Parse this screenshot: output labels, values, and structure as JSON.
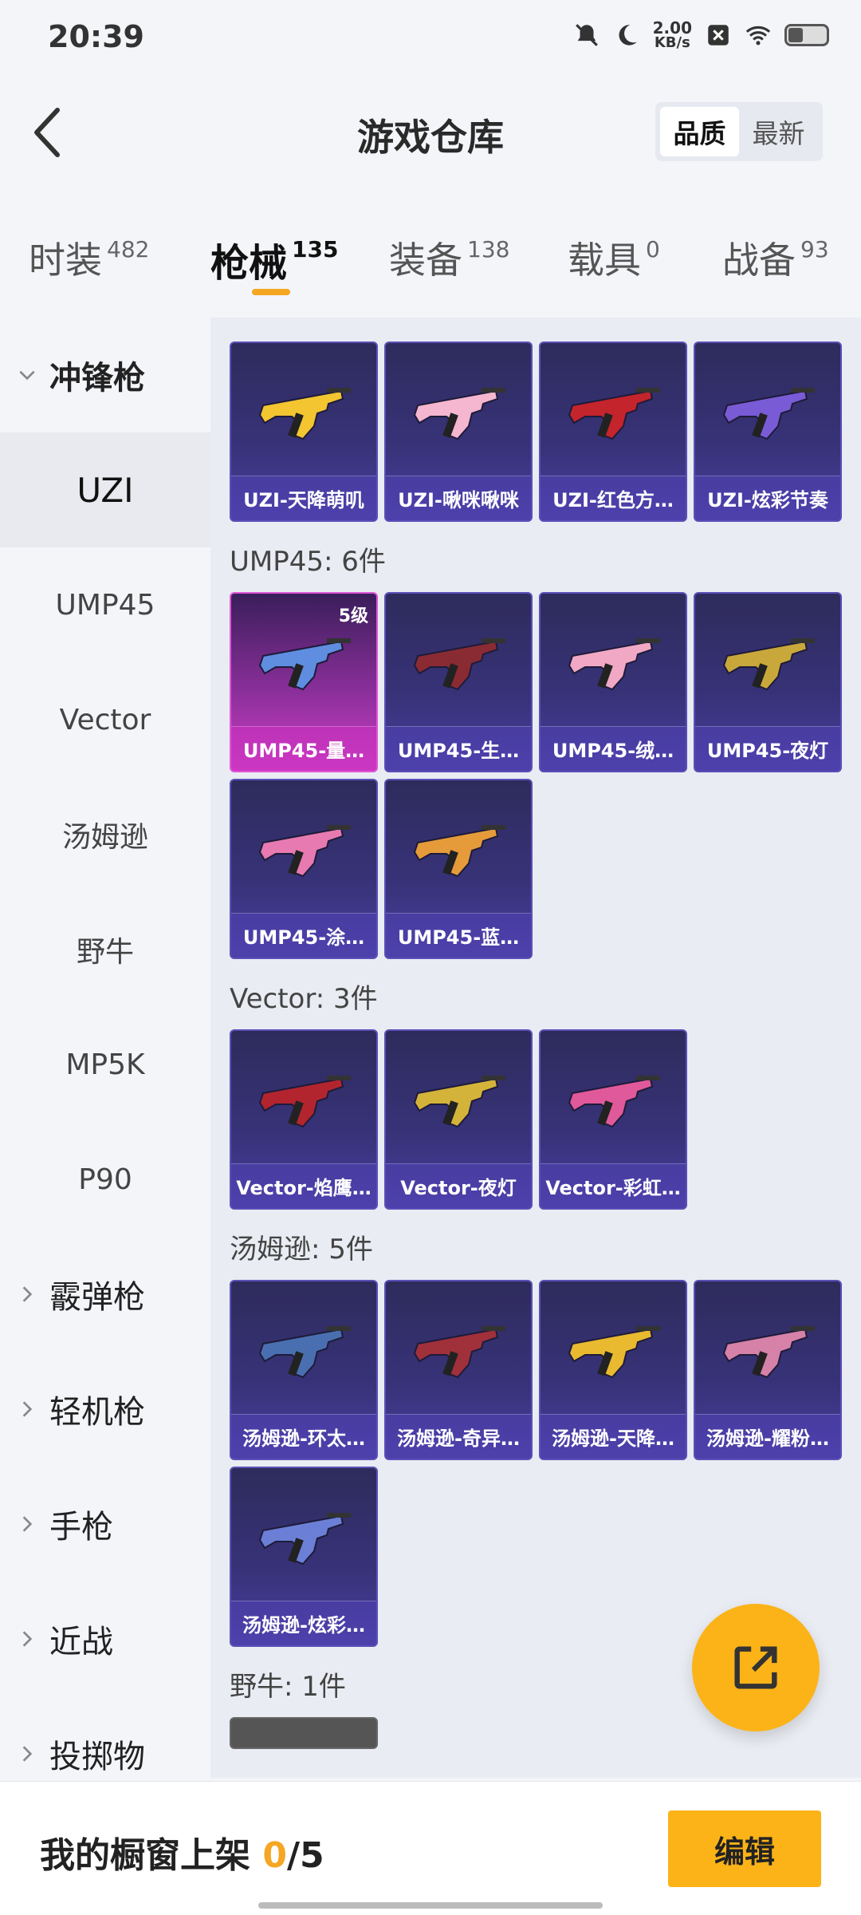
{
  "status": {
    "time": "20:39",
    "net_speed": "2.00",
    "net_unit": "KB/s",
    "icons": [
      "mute-icon",
      "moon-icon",
      "close-box-icon",
      "wifi-icon",
      "battery-icon"
    ]
  },
  "header": {
    "title": "游戏仓库",
    "sort_options": [
      {
        "label": "品质",
        "active": true
      },
      {
        "label": "最新",
        "active": false
      }
    ]
  },
  "categories": [
    {
      "label": "时装",
      "count": "482",
      "active": false
    },
    {
      "label": "枪械",
      "count": "135",
      "active": true
    },
    {
      "label": "装备",
      "count": "138",
      "active": false
    },
    {
      "label": "载具",
      "count": "0",
      "active": false
    },
    {
      "label": "战备",
      "count": "93",
      "active": false
    }
  ],
  "sidebar": {
    "groups": [
      {
        "label": "冲锋枪",
        "open": true
      },
      {
        "label": "霰弹枪"
      },
      {
        "label": "轻机枪"
      },
      {
        "label": "手枪"
      },
      {
        "label": "近战"
      },
      {
        "label": "投掷物"
      }
    ],
    "subitems": [
      {
        "label": "UZI",
        "active": true
      },
      {
        "label": "UMP45"
      },
      {
        "label": "Vector"
      },
      {
        "label": "汤姆逊"
      },
      {
        "label": "野牛"
      },
      {
        "label": "MP5K"
      },
      {
        "label": "P90"
      }
    ]
  },
  "sections": [
    {
      "title": "",
      "items": [
        {
          "name": "UZI-天降萌叽",
          "color": "#f2c531"
        },
        {
          "name": "UZI-啾咪啾咪",
          "color": "#f4b7cf"
        },
        {
          "name": "UZI-红色方…",
          "color": "#c4242b"
        },
        {
          "name": "UZI-炫彩节奏",
          "color": "#7a5bd6"
        }
      ]
    },
    {
      "title": "UMP45: 6件",
      "items": [
        {
          "name": "UMP45-量…",
          "level": "5级",
          "highlight": true,
          "color": "#5f8de0"
        },
        {
          "name": "UMP45-生…",
          "color": "#8a2b33"
        },
        {
          "name": "UMP45-绒…",
          "color": "#f0a8c4"
        },
        {
          "name": "UMP45-夜灯",
          "color": "#c8a83a"
        },
        {
          "name": "UMP45-涂…",
          "color": "#e77ab0"
        },
        {
          "name": "UMP45-蓝…",
          "color": "#e69b3a"
        }
      ]
    },
    {
      "title": "Vector: 3件",
      "items": [
        {
          "name": "Vector-焰鹰…",
          "color": "#b3252e"
        },
        {
          "name": "Vector-夜灯",
          "color": "#d4b33a"
        },
        {
          "name": "Vector-彩虹…",
          "color": "#e0599a"
        }
      ]
    },
    {
      "title": "汤姆逊: 5件",
      "items": [
        {
          "name": "汤姆逊-环太…",
          "color": "#4a6fb0"
        },
        {
          "name": "汤姆逊-奇异…",
          "color": "#a0303a"
        },
        {
          "name": "汤姆逊-天降…",
          "color": "#e9b92f"
        },
        {
          "name": "汤姆逊-耀粉…",
          "color": "#d681a8"
        },
        {
          "name": "汤姆逊-炫彩…",
          "color": "#6b7fd6"
        }
      ]
    },
    {
      "title": "野牛: 1件",
      "items": []
    }
  ],
  "footer": {
    "showcase_label": "我的橱窗上架",
    "showcase_current": "0",
    "showcase_total": "/5",
    "edit_label": "编辑"
  },
  "colors": {
    "accent": "#fbb318",
    "card_base": "#38337a",
    "card_highlight": "#d23ec8"
  }
}
